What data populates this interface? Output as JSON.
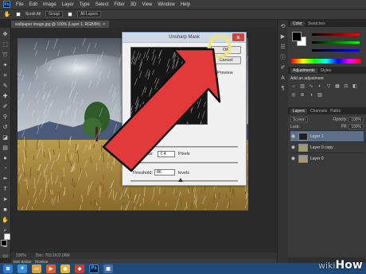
{
  "menubar": {
    "logo": "Ps",
    "items": [
      "File",
      "Edit",
      "Image",
      "Layer",
      "Type",
      "Select",
      "Filter",
      "3D",
      "View",
      "Window",
      "Help"
    ]
  },
  "options_bar": {
    "scroll_all": "Scroll All",
    "group": "Group",
    "all_layers": "All Layers"
  },
  "document_tab": {
    "title": "wallpaper image.jpg @ 100% (Layer 1, RGB/8#)",
    "close": "×"
  },
  "dialog": {
    "title": "Unsharp Mask",
    "close": "x",
    "ok_label": "OK",
    "cancel_label": "Cancel",
    "preview_label": "Preview",
    "preview_checked": true,
    "radius_label": "Radius:",
    "radius_value": "7.4",
    "radius_unit": "Pixels",
    "threshold_label": "Threshold:",
    "threshold_value": "86",
    "threshold_unit": "levels"
  },
  "panels": {
    "color_tab": "Color",
    "swatches_tab": "Swatches",
    "adjustments_tab": "Adjustments",
    "styles_tab": "Styles",
    "add_adjustment": "Add an adjustment",
    "layers_tab": "Layers",
    "channels_tab": "Channels",
    "paths_tab": "Paths",
    "blend_mode": "Screen",
    "opacity_label": "Opacity:",
    "opacity_value": "100%",
    "lock_label": "Lock:",
    "fill_label": "Fill:",
    "fill_value": "100%",
    "layers": [
      {
        "name": "Layer 1",
        "selected": true
      },
      {
        "name": "Layer 0 copy",
        "selected": false
      },
      {
        "name": "Layer 0",
        "selected": false
      }
    ]
  },
  "status": {
    "doc": "Doc: 703.1K/2.06M"
  },
  "bottom_tabs": [
    "Mini Bridge",
    "Timeline"
  ],
  "watermark": {
    "wiki": "wiki",
    "how": "How"
  },
  "colors": {
    "arrow": "#e23a3a",
    "highlight": "#f2e27a",
    "taskbar": "#1d4a78"
  }
}
